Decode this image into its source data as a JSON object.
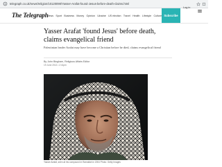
{
  "browser": {
    "url": "telegraph.co.uk/news/religion/10120090/Yasser-Arafat-found-Jesus-before-death-claims.html"
  },
  "header": {
    "logo": "The Telegraph",
    "nav": [
      "News",
      "Sport",
      "Business",
      "Money",
      "Opinion",
      "Ukraine",
      "US election",
      "Travel",
      "Health",
      "Lifestyle",
      "Culture",
      "Puzzles"
    ],
    "subscribe_label": "Subscribe",
    "login_label": "Log in"
  },
  "article": {
    "headline": "Yasser Arafat 'found Jesus' before death, claims evangelical friend",
    "standfirst": "Palestinian leader Arafat may have become a Christian before he died, claims evangelical friend",
    "byline": "By John Bingham, Religious Affairs Editor",
    "date": "19 June 2013 • 2:41pm",
    "caption": "Yasser Arafat, seen at his compound in Ramallah in 2004 Photo: Getty Images"
  },
  "colors": {
    "accent": "#2ab4b4"
  }
}
